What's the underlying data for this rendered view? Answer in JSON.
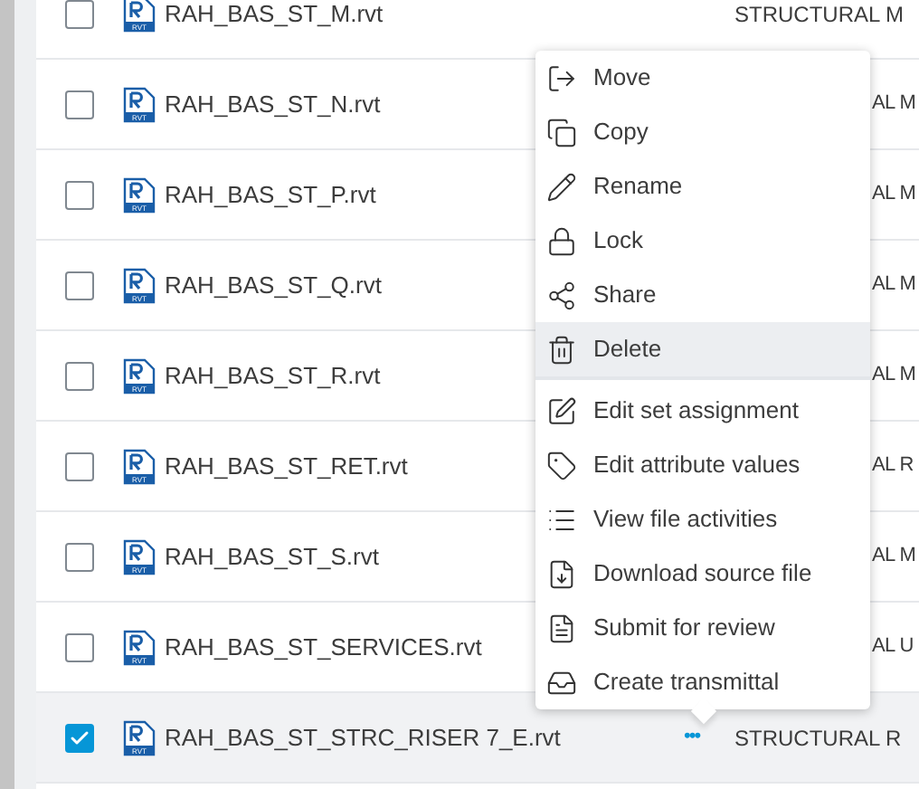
{
  "files": [
    {
      "name": "RAH_BAS_ST_M.rvt",
      "badge": "RVT",
      "checked": false,
      "selected": false,
      "column_2": "STRUCTURAL M"
    },
    {
      "name": "RAH_BAS_ST_N.rvt",
      "badge": "RVT",
      "checked": false,
      "selected": false,
      "column_2": "AL M"
    },
    {
      "name": "RAH_BAS_ST_P.rvt",
      "badge": "RVT",
      "checked": false,
      "selected": false,
      "column_2": "AL M"
    },
    {
      "name": "RAH_BAS_ST_Q.rvt",
      "badge": "RVT",
      "checked": false,
      "selected": false,
      "column_2": "AL M"
    },
    {
      "name": "RAH_BAS_ST_R.rvt",
      "badge": "RVT",
      "checked": false,
      "selected": false,
      "column_2": "AL M"
    },
    {
      "name": "RAH_BAS_ST_RET.rvt",
      "badge": "RVT",
      "checked": false,
      "selected": false,
      "column_2": "AL R"
    },
    {
      "name": "RAH_BAS_ST_S.rvt",
      "badge": "RVT",
      "checked": false,
      "selected": false,
      "column_2": "AL M"
    },
    {
      "name": "RAH_BAS_ST_SERVICES.rvt",
      "badge": "RVT",
      "checked": false,
      "selected": false,
      "column_2": "AL U"
    },
    {
      "name": "RAH_BAS_ST_STRC_RISER 7_E.rvt",
      "badge": "RVT",
      "checked": true,
      "selected": true,
      "actions": "•••",
      "column_2": "STRUCTURAL R"
    }
  ],
  "context_menu": {
    "groups": [
      [
        {
          "label": "Move",
          "kind": "move",
          "selected": false
        },
        {
          "label": "Copy",
          "kind": "copy",
          "selected": false
        },
        {
          "label": "Rename",
          "kind": "rename",
          "selected": false
        },
        {
          "label": "Lock",
          "kind": "lock",
          "selected": false
        },
        {
          "label": "Share",
          "kind": "share",
          "selected": false
        },
        {
          "label": "Delete",
          "kind": "delete",
          "selected": true
        }
      ],
      [
        {
          "label": "Edit set assignment",
          "kind": "edit-set",
          "selected": false
        },
        {
          "label": "Edit attribute values",
          "kind": "edit-attributes",
          "selected": false
        },
        {
          "label": "View file activities",
          "kind": "activities",
          "selected": false
        },
        {
          "label": "Download source file",
          "kind": "download",
          "selected": false
        },
        {
          "label": "Submit for review",
          "kind": "review",
          "selected": false
        },
        {
          "label": "Create transmittal",
          "kind": "transmittal",
          "selected": false
        }
      ]
    ]
  }
}
